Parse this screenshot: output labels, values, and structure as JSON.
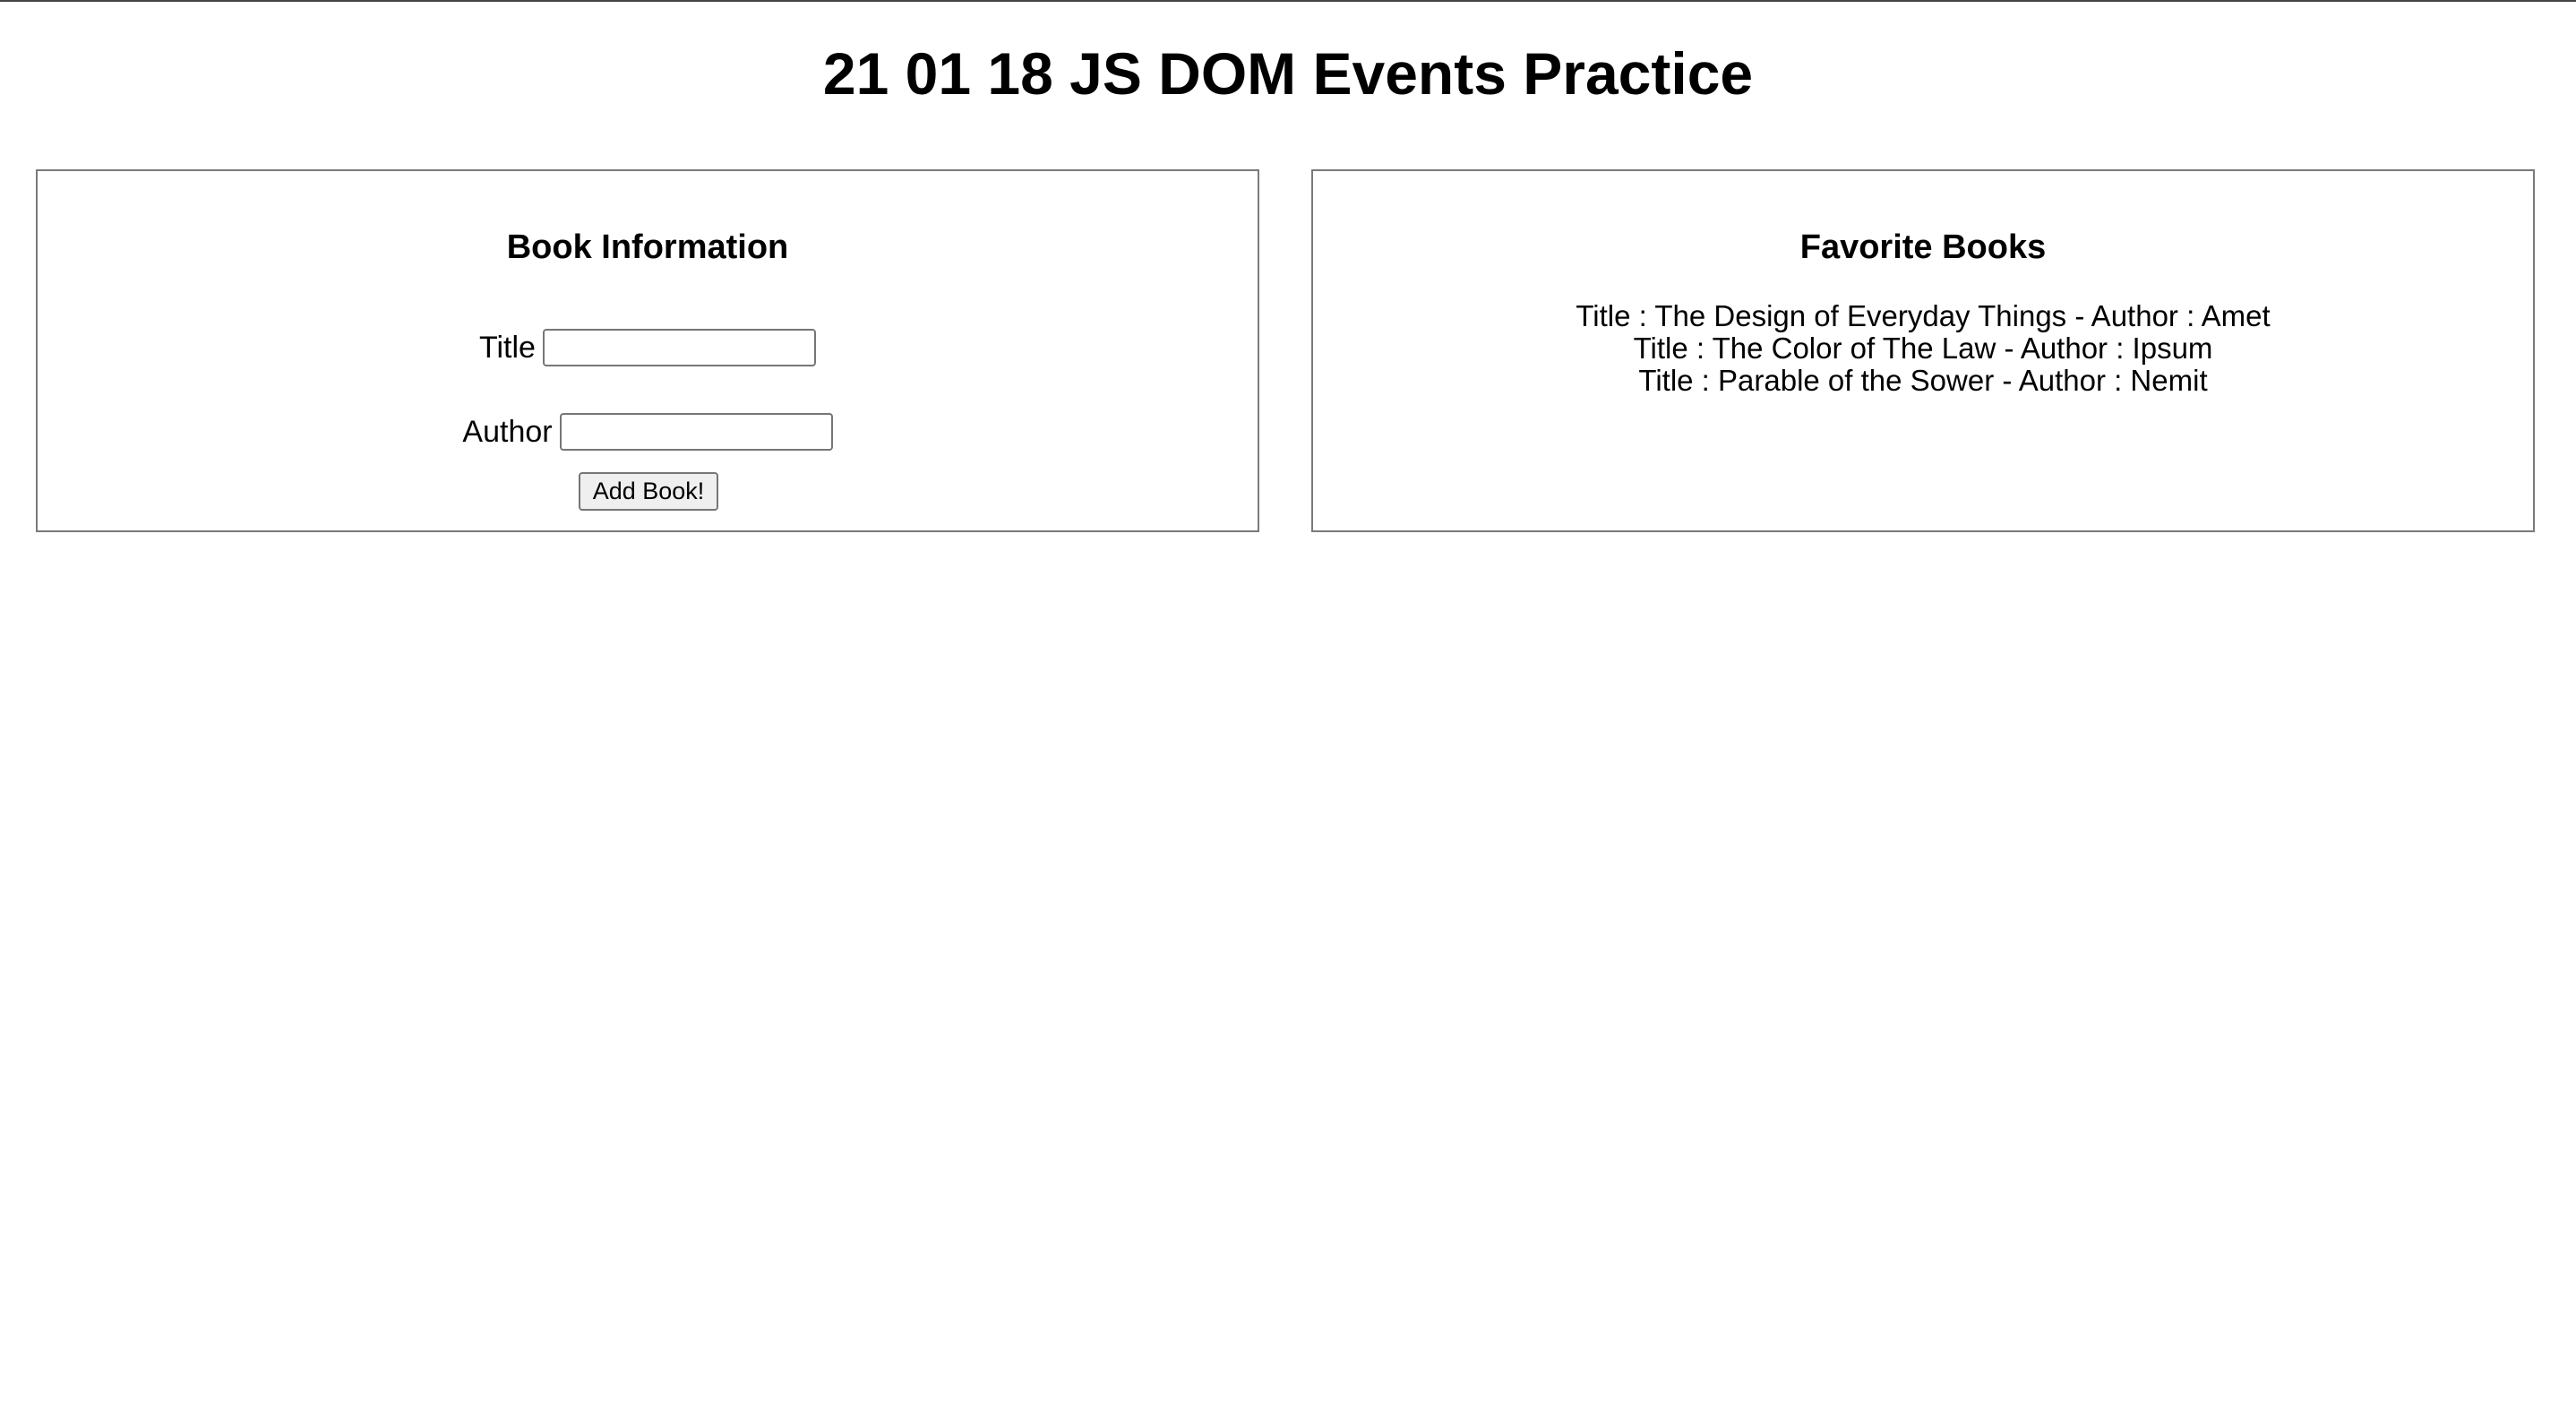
{
  "header": {
    "title": "21 01 18 JS DOM Events Practice"
  },
  "book_form": {
    "heading": "Book Information",
    "title_label": "Title",
    "title_value": "",
    "author_label": "Author",
    "author_value": "",
    "submit_label": "Add Book!"
  },
  "favorites": {
    "heading": "Favorite Books",
    "books": [
      "Title : The Design of Everyday Things - Author : Amet",
      "Title : The Color of The Law - Author : Ipsum",
      "Title : Parable of the Sower - Author : Nemit"
    ]
  }
}
